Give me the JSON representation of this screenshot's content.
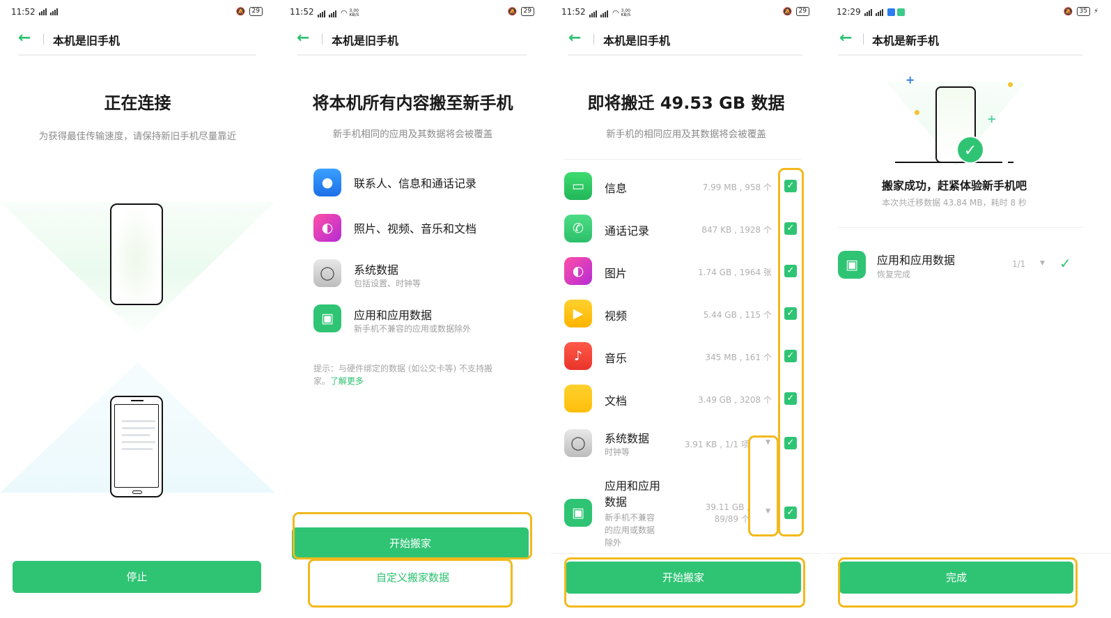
{
  "screens": [
    {
      "status": {
        "time": "11:52",
        "battery": "29"
      },
      "title": "本机是旧手机",
      "heading": "正在连接",
      "subtitle": "为获得最佳传输速度，请保持新旧手机尽量靠近",
      "primary_button": "停止"
    },
    {
      "status": {
        "time": "11:52",
        "battery": "29",
        "speed": "3.00 KB/S"
      },
      "title": "本机是旧手机",
      "heading": "将本机所有内容搬至新手机",
      "subtitle": "新手机相同的应用及其数据将会被覆盖",
      "categories": [
        {
          "label": "联系人、信息和通话记录",
          "desc": ""
        },
        {
          "label": "照片、视频、音乐和文档",
          "desc": ""
        },
        {
          "label": "系统数据",
          "desc": "包括设置、时钟等"
        },
        {
          "label": "应用和应用数据",
          "desc": "新手机不兼容的应用或数据除外"
        }
      ],
      "tip_text": "提示：与硬件绑定的数据 (如公交卡等) 不支持搬家。",
      "tip_link": "了解更多",
      "primary_button": "开始搬家",
      "secondary_link": "自定义搬家数据"
    },
    {
      "status": {
        "time": "11:52",
        "battery": "29",
        "speed": "3.00 KB/S"
      },
      "title": "本机是旧手机",
      "heading": "即将搬迁 49.53 GB 数据",
      "subtitle": "新手机的相同应用及其数据将会被覆盖",
      "rows": [
        {
          "label": "信息",
          "meta": "7.99 MB , 958 个"
        },
        {
          "label": "通话记录",
          "meta": "847 KB , 1928 个"
        },
        {
          "label": "图片",
          "meta": "1.74 GB , 1964 张"
        },
        {
          "label": "视频",
          "meta": "5.44 GB , 115 个"
        },
        {
          "label": "音乐",
          "meta": "345 MB , 161 个"
        },
        {
          "label": "文档",
          "meta": "3.49 GB , 3208 个"
        },
        {
          "label": "系统数据",
          "meta": "3.91 KB , 1/1 项",
          "desc": "时钟等"
        },
        {
          "label": "应用和应用数据",
          "meta": "39.11 GB , 89/89 个",
          "desc": "新手机不兼容的应用或数据除外"
        }
      ],
      "primary_button": "开始搬家"
    },
    {
      "status": {
        "time": "12:29",
        "battery": "35"
      },
      "title": "本机是新手机",
      "success_title": "搬家成功，赶紧体验新手机吧",
      "success_sub": "本次共迁移数据 43.84 MB，耗时 8 秒",
      "app_row": {
        "label": "应用和应用数据",
        "desc": "恢复完成",
        "count": "1/1"
      },
      "primary_button": "完成"
    }
  ],
  "colors": {
    "accent": "#2fc474",
    "highlight": "#f2b91c"
  }
}
